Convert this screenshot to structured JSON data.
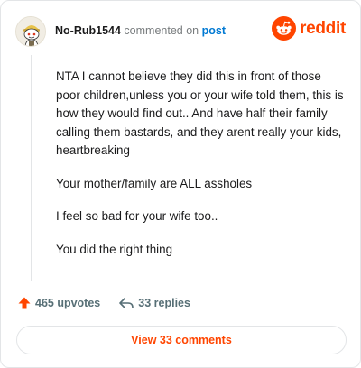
{
  "header": {
    "username": "No-Rub1544",
    "action_text": "commented on",
    "post_link": "post",
    "brand_wordmark": "reddit"
  },
  "comment": {
    "paragraphs": [
      "NTA I cannot believe they did this in front of those poor children,unless you or your wife told them, this is how they would find out.. And have half their family calling them bastards, and they arent really your kids, heartbreaking",
      "Your mother/family are ALL assholes",
      "I feel so bad for your wife too..",
      "You did the right thing"
    ]
  },
  "actions": {
    "upvotes": "465 upvotes",
    "replies": "33 replies"
  },
  "footer": {
    "view_comments": "View 33 comments"
  },
  "colors": {
    "brand": "#ff4500",
    "link": "#0079d3",
    "muted": "#787c7e",
    "action": "#576f76",
    "border": "#e3e5e7"
  },
  "icons": {
    "avatar": "snoo-avatar",
    "brand": "reddit-logo-icon",
    "upvote": "upvote-arrow-icon",
    "reply": "reply-arrow-icon"
  }
}
